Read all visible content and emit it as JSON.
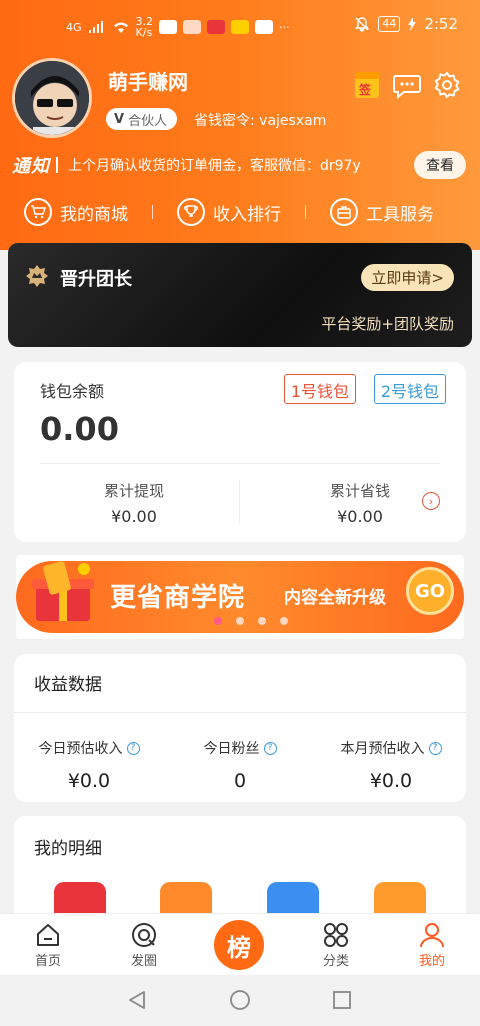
{
  "status_bar": {
    "network_speed": "3.2\nK/s",
    "network_speed_line1": "3.2",
    "network_speed_line2": "K/s",
    "signal": "4G",
    "battery": "44",
    "time": "2:52"
  },
  "profile": {
    "name": "萌手赚网",
    "badge": "合伙人",
    "badge_mark": "V",
    "code_label": "省钱密令: vajesxam",
    "sign_badge": "签"
  },
  "notice": {
    "tag": "通知",
    "text": "上个月确认收货的订单佣金，客服微信：dr97y",
    "button": "查看"
  },
  "shortcuts": [
    {
      "label": "我的商城",
      "icon": "cart-icon"
    },
    {
      "label": "收入排行",
      "icon": "trophy-icon"
    },
    {
      "label": "工具服务",
      "icon": "toolbox-icon"
    }
  ],
  "promotion": {
    "title": "晋升团长",
    "button": "立即申请>",
    "subtitle": "平台奖励+团队奖励"
  },
  "wallet": {
    "label": "钱包余额",
    "balance": "0.00",
    "wallet1": "1号钱包",
    "wallet2": "2号钱包",
    "withdraw_label": "累计提现",
    "withdraw_value": "¥0.00",
    "saved_label": "累计省钱",
    "saved_value": "¥0.00"
  },
  "banner": {
    "title": "更省商学院",
    "tag": "内容全新升级",
    "go": "GO",
    "dots": 4,
    "active_dot": 0
  },
  "earnings": {
    "title": "收益数据",
    "items": [
      {
        "label": "今日预估收入",
        "value": "¥0.0"
      },
      {
        "label": "今日粉丝",
        "value": "0"
      },
      {
        "label": "本月预估收入",
        "value": "¥0.0"
      }
    ]
  },
  "details": {
    "title": "我的明细",
    "icon_colors": [
      "#e8343a",
      "#ff8a2c",
      "#3a8ff0",
      "#ff9a2c"
    ]
  },
  "tabbar": {
    "items": [
      {
        "label": "首页",
        "icon": "home-icon"
      },
      {
        "label": "发圈",
        "icon": "moments-icon"
      },
      {
        "label": "榜",
        "icon": "rank-icon"
      },
      {
        "label": "分类",
        "icon": "category-icon"
      },
      {
        "label": "我的",
        "icon": "profile-icon"
      }
    ],
    "active": 4
  },
  "colors": {
    "accent": "#ff6a13",
    "active_tab": "#ff5a1f"
  }
}
